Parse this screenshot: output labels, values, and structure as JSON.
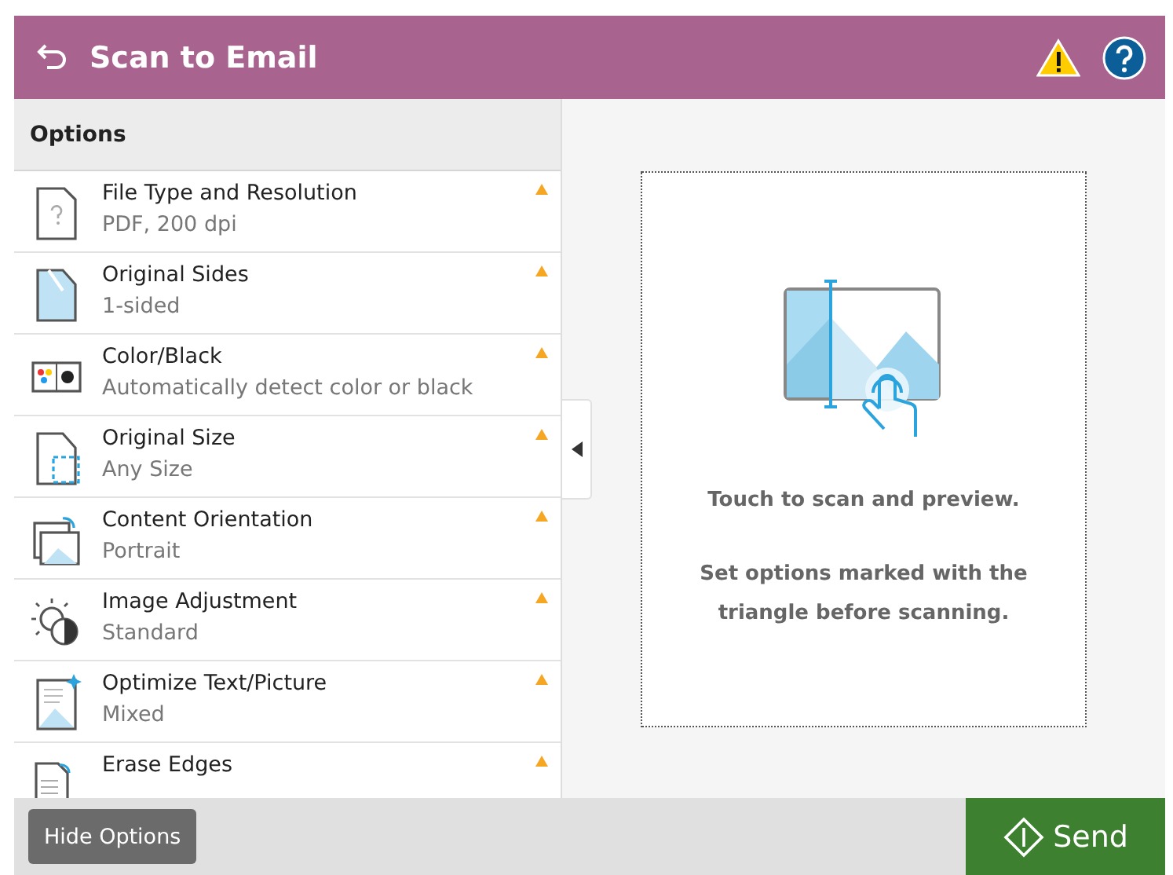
{
  "header": {
    "title": "Scan to Email"
  },
  "options": {
    "title": "Options",
    "items": [
      {
        "kind": "file",
        "label": "File Type and Resolution",
        "value": "PDF, 200 dpi",
        "marked": true
      },
      {
        "kind": "sides",
        "label": "Original Sides",
        "value": "1-sided",
        "marked": true
      },
      {
        "kind": "color",
        "label": "Color/Black",
        "value": "Automatically detect color or black",
        "marked": true
      },
      {
        "kind": "size",
        "label": "Original Size",
        "value": "Any Size",
        "marked": true
      },
      {
        "kind": "orientation",
        "label": "Content Orientation",
        "value": "Portrait",
        "marked": true
      },
      {
        "kind": "adjust",
        "label": "Image Adjustment",
        "value": "Standard",
        "marked": true
      },
      {
        "kind": "optimize",
        "label": "Optimize Text/Picture",
        "value": "Mixed",
        "marked": true
      },
      {
        "kind": "erase",
        "label": "Erase Edges",
        "marked": true
      }
    ]
  },
  "preview": {
    "line_1": "Touch to scan and preview.",
    "line_2": "Set options marked with the triangle before scanning."
  },
  "footer": {
    "hide_button": "Hide Options",
    "send_button": "Send"
  }
}
